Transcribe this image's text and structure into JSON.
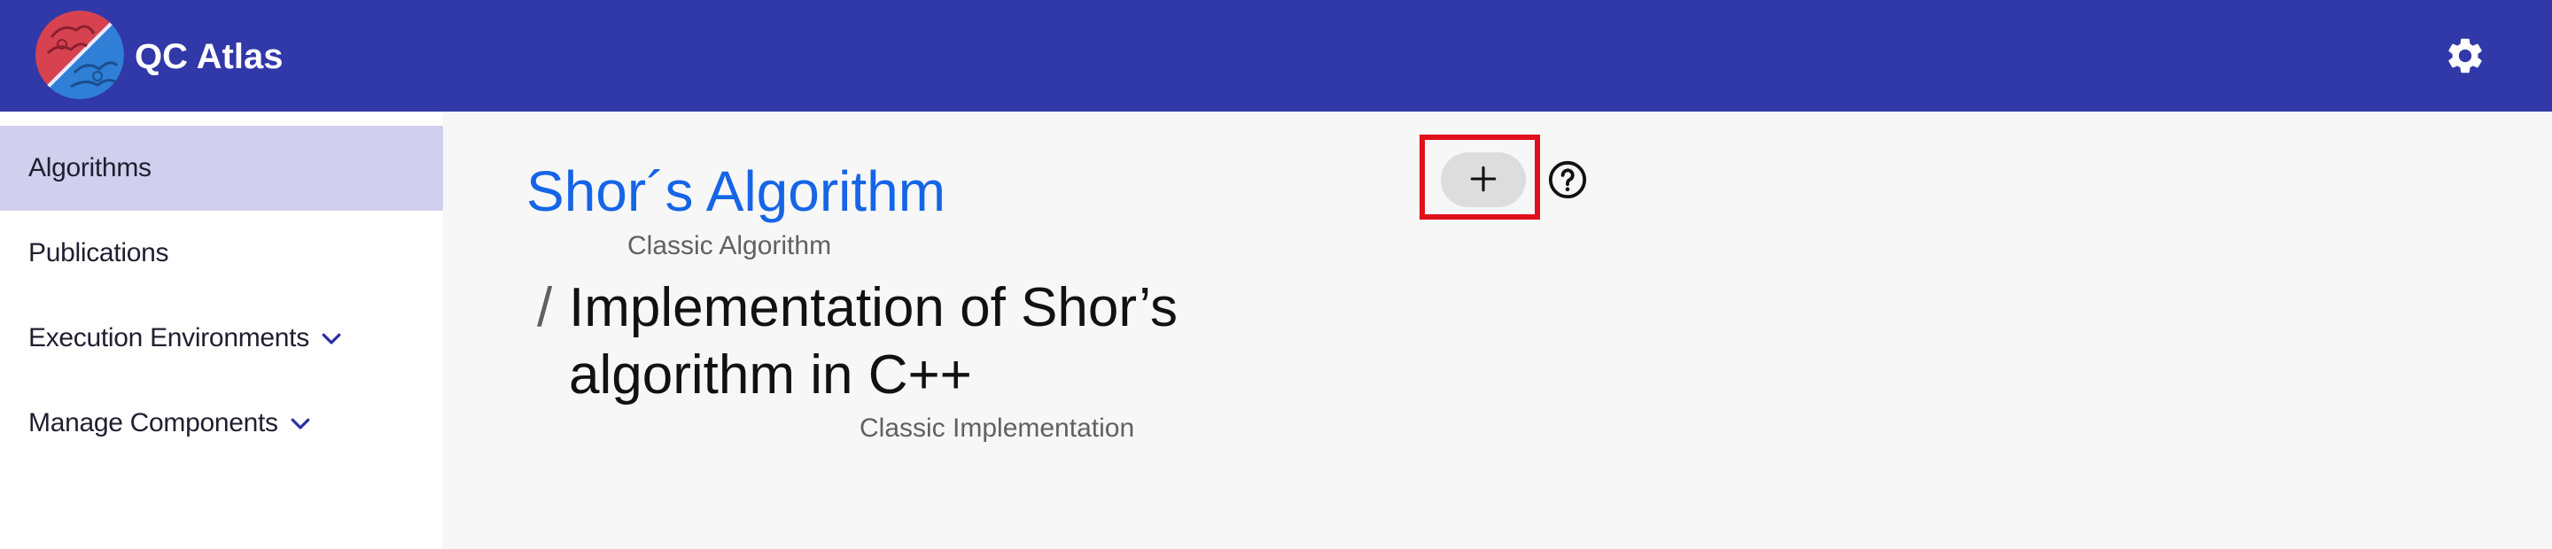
{
  "header": {
    "app_title": "QC Atlas",
    "logo_icon": "qc-atlas-logo",
    "settings_icon": "gear-icon",
    "background_color": "#3138a8"
  },
  "sidebar": {
    "items": [
      {
        "label": "Algorithms",
        "active": true,
        "has_chevron": false
      },
      {
        "label": "Publications",
        "active": false,
        "has_chevron": false
      },
      {
        "label": "Execution Environments",
        "active": false,
        "has_chevron": true
      },
      {
        "label": "Manage Components",
        "active": false,
        "has_chevron": true
      }
    ],
    "active_color": "#d0d0ee"
  },
  "main": {
    "algorithm_title": "Shor´s Algorithm",
    "algorithm_type": "Classic Algorithm",
    "separator": "/",
    "implementation_title": "Implementation of Shor’s algorithm in C++",
    "implementation_type": "Classic Implementation",
    "add_button_icon": "plus-icon",
    "help_icon": "help-circle-icon",
    "link_color": "#1565e6",
    "highlight_color": "#e0101c"
  }
}
